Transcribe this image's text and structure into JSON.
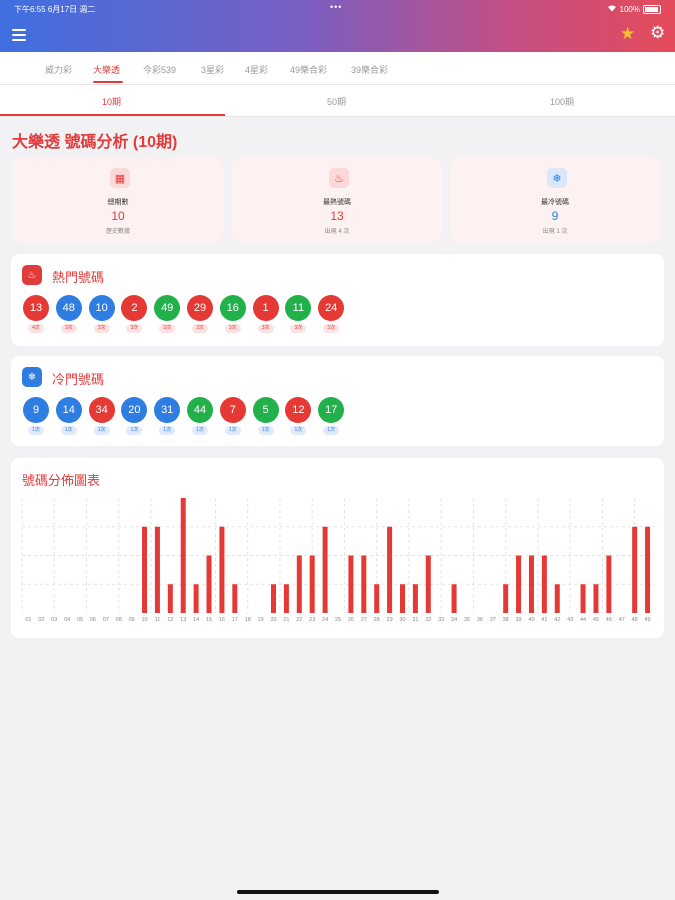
{
  "status_bar": {
    "time": "下午6:55",
    "date": "6月17日 週二",
    "dots": "•••",
    "battery": "100%"
  },
  "icons": {
    "menu": "menu-icon",
    "favorite": "star-icon",
    "settings": "gear-icon",
    "wifi": "wifi-icon",
    "battery": "battery-icon"
  },
  "lottery_tabs": [
    {
      "label": "威力彩",
      "active": false
    },
    {
      "label": "大樂透",
      "active": true
    },
    {
      "label": "今彩539",
      "active": false
    },
    {
      "label": "3星彩",
      "active": false
    },
    {
      "label": "4星彩",
      "active": false
    },
    {
      "label": "49樂合彩",
      "active": false
    },
    {
      "label": "39樂合彩",
      "active": false
    }
  ],
  "period_tabs": [
    {
      "label": "10期",
      "active": true
    },
    {
      "label": "50期",
      "active": false
    },
    {
      "label": "100期",
      "active": false
    }
  ],
  "page_title": "大樂透 號碼分析 (10期)",
  "stats": [
    {
      "label": "總期數",
      "value": "10",
      "sub": "歷史數據",
      "icon": "calendar-icon",
      "color": "#e23b3b"
    },
    {
      "label": "最熱號碼",
      "value": "13",
      "sub": "出現 4 次",
      "icon": "fire-icon",
      "color": "#e23b3b"
    },
    {
      "label": "最冷號碼",
      "value": "9",
      "sub": "出現 1 次",
      "icon": "snowflake-icon",
      "color": "#2f7de1"
    }
  ],
  "hot_numbers": {
    "title": "熱門號碼",
    "icon": "fire-icon",
    "balls": [
      {
        "number": "13",
        "count": "4次"
      },
      {
        "number": "48",
        "count": "3次"
      },
      {
        "number": "10",
        "count": "3次"
      },
      {
        "number": "2",
        "count": "3次"
      },
      {
        "number": "49",
        "count": "3次"
      },
      {
        "number": "29",
        "count": "3次"
      },
      {
        "number": "16",
        "count": "3次"
      },
      {
        "number": "1",
        "count": "3次"
      },
      {
        "number": "11",
        "count": "3次"
      },
      {
        "number": "24",
        "count": "3次"
      }
    ]
  },
  "cold_numbers": {
    "title": "冷門號碼",
    "icon": "snowflake-icon",
    "balls": [
      {
        "number": "9",
        "count": "1次"
      },
      {
        "number": "14",
        "count": "1次"
      },
      {
        "number": "34",
        "count": "1次"
      },
      {
        "number": "20",
        "count": "1次"
      },
      {
        "number": "31",
        "count": "1次"
      },
      {
        "number": "44",
        "count": "1次"
      },
      {
        "number": "7",
        "count": "1次"
      },
      {
        "number": "5",
        "count": "1次"
      },
      {
        "number": "12",
        "count": "1次"
      },
      {
        "number": "17",
        "count": "1次"
      }
    ]
  },
  "colors": {
    "red": "#e53935",
    "blue": "#2f7de1",
    "green": "#22b04b",
    "accent": "#e23b3b"
  },
  "chart_title": "號碼分佈圖表",
  "chart_data": {
    "type": "bar",
    "categories": [
      "01",
      "02",
      "03",
      "04",
      "05",
      "06",
      "07",
      "08",
      "09",
      "10",
      "11",
      "12",
      "13",
      "14",
      "15",
      "16",
      "17",
      "18",
      "19",
      "20",
      "21",
      "22",
      "23",
      "24",
      "25",
      "26",
      "27",
      "28",
      "29",
      "30",
      "31",
      "32",
      "33",
      "34",
      "35",
      "36",
      "37",
      "38",
      "39",
      "40",
      "41",
      "42",
      "43",
      "44",
      "45",
      "46",
      "47",
      "48",
      "49"
    ],
    "values": [
      0,
      0,
      0,
      0,
      0,
      0,
      0,
      0,
      0,
      3,
      3,
      1,
      4,
      1,
      2,
      3,
      1,
      0,
      0,
      1,
      1,
      2,
      2,
      3,
      0,
      2,
      2,
      1,
      3,
      1,
      1,
      2,
      0,
      1,
      0,
      0,
      0,
      1,
      2,
      2,
      2,
      1,
      0,
      1,
      1,
      2,
      0,
      3,
      3
    ],
    "ylim": [
      0,
      4
    ],
    "grid": true,
    "color": "#e53935"
  }
}
